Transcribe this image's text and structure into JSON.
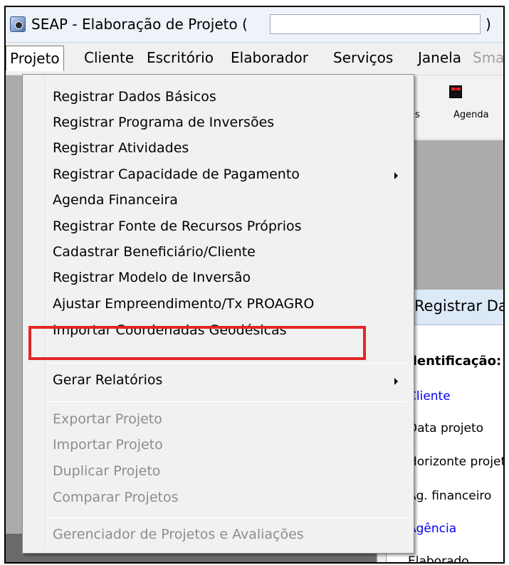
{
  "window": {
    "title": "SEAP - Elaboração de Projeto (",
    "title_close_paren": ")"
  },
  "menubar": {
    "items": [
      {
        "label": "Projeto"
      },
      {
        "label": "Cliente"
      },
      {
        "label": "Escritório"
      },
      {
        "label": "Elaborador"
      },
      {
        "label": "Serviços"
      },
      {
        "label": "Janela"
      },
      {
        "label": "Sma"
      }
    ]
  },
  "toolbar": {
    "label_partial": "ões",
    "agenda_label": "Agenda"
  },
  "form": {
    "header_title": "Registrar Dad",
    "section_title": "dentificação:",
    "fields": [
      {
        "label": "Cliente"
      },
      {
        "label": "Data projeto"
      },
      {
        "label": "Horizonte projeto"
      },
      {
        "label": "Ag. financeiro"
      },
      {
        "label": "Agência"
      },
      {
        "label": "Elaborado"
      }
    ]
  },
  "dropdown": {
    "items": [
      {
        "label": "Registrar Dados Básicos"
      },
      {
        "label": "Registrar Programa de Inversões"
      },
      {
        "label": "Registrar Atividades"
      },
      {
        "label": "Registrar Capacidade de Pagamento"
      },
      {
        "label": "Agenda Financeira"
      },
      {
        "label": "Registrar Fonte de Recursos Próprios"
      },
      {
        "label": "Cadastrar Beneficiário/Cliente"
      },
      {
        "label": "Registrar Modelo de Inversão"
      },
      {
        "label": "Ajustar Empreendimento/Tx PROAGRO"
      },
      {
        "label": "Importar Coordenadas Geodésicas"
      },
      {
        "label": "Gerar Relatórios"
      },
      {
        "label": "Exportar Projeto"
      },
      {
        "label": "Importar Projeto"
      },
      {
        "label": "Duplicar Projeto"
      },
      {
        "label": "Comparar Projetos"
      },
      {
        "label": "Gerenciador de Projetos e Avaliações"
      }
    ]
  },
  "colors": {
    "highlight": "#e32626",
    "link": "#0000ee",
    "disabled_text": "#8d8d8d"
  }
}
